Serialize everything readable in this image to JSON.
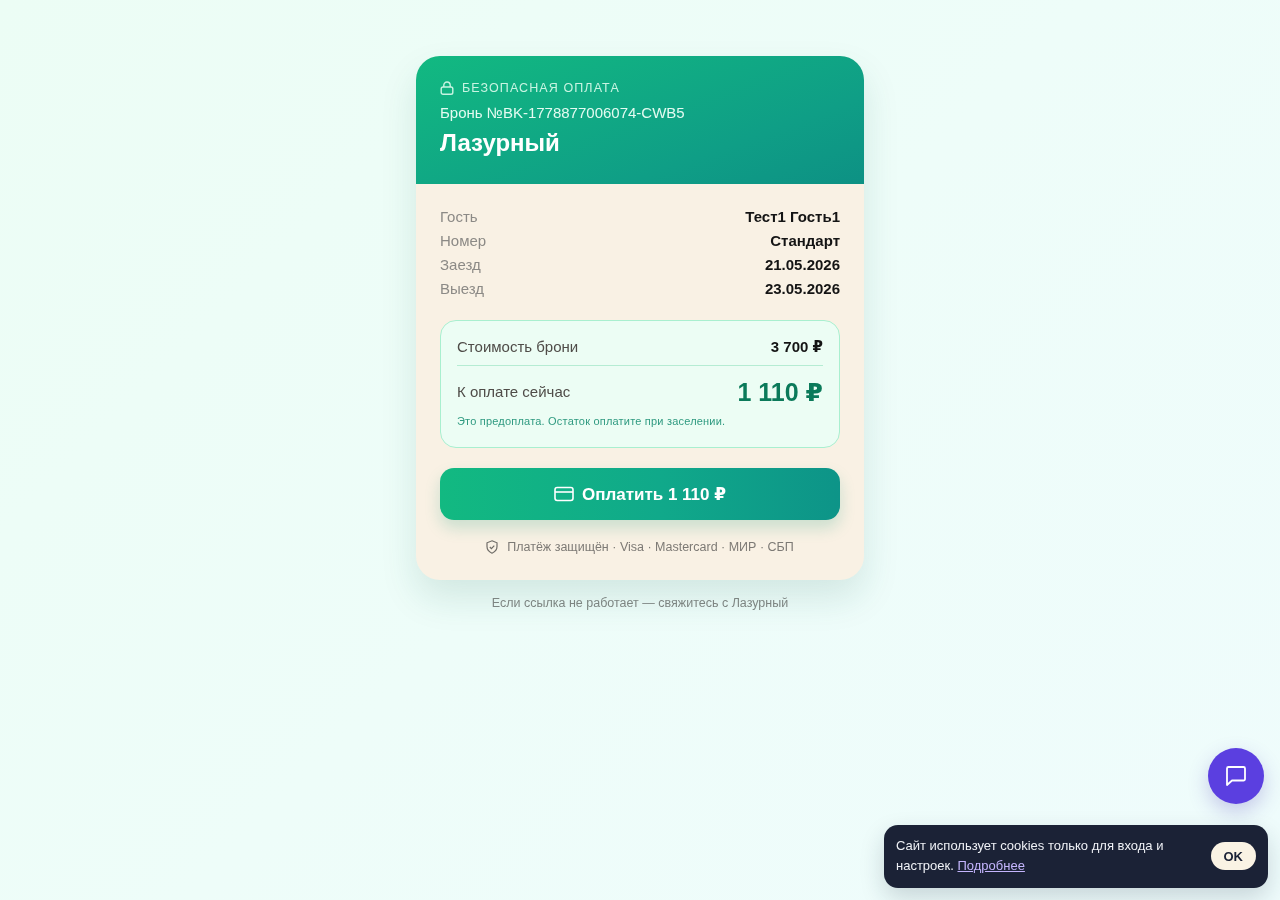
{
  "header": {
    "badge": "БЕЗОПАСНАЯ ОПЛАТА",
    "booking_number": "Бронь №BK-1778877006074-CWB5",
    "hotel_name": "Лазурный"
  },
  "details": [
    {
      "label": "Гость",
      "value": "Тест1 Гость1"
    },
    {
      "label": "Номер",
      "value": "Стандарт"
    },
    {
      "label": "Заезд",
      "value": "21.05.2026"
    },
    {
      "label": "Выезд",
      "value": "23.05.2026"
    }
  ],
  "price": {
    "rows": [
      {
        "kind": "total",
        "label": "Стоимость брони",
        "amount": "3 700 ₽"
      },
      {
        "kind": "due",
        "label": "К оплате сейчас",
        "amount": "1 110 ₽"
      }
    ],
    "note": "Это предоплата. Остаток оплатите при заселении."
  },
  "pay_button": {
    "label": "Оплатить 1 110 ₽"
  },
  "security_note": "Платёж защищён · Visa · Mastercard · МИР · СБП",
  "help_text": "Если ссылка не работает — свяжитесь с Лазурный",
  "cookie_banner": {
    "text": "Сайт использует cookies только для входа и настроек.",
    "link": "Подробнее",
    "button": "OK"
  }
}
